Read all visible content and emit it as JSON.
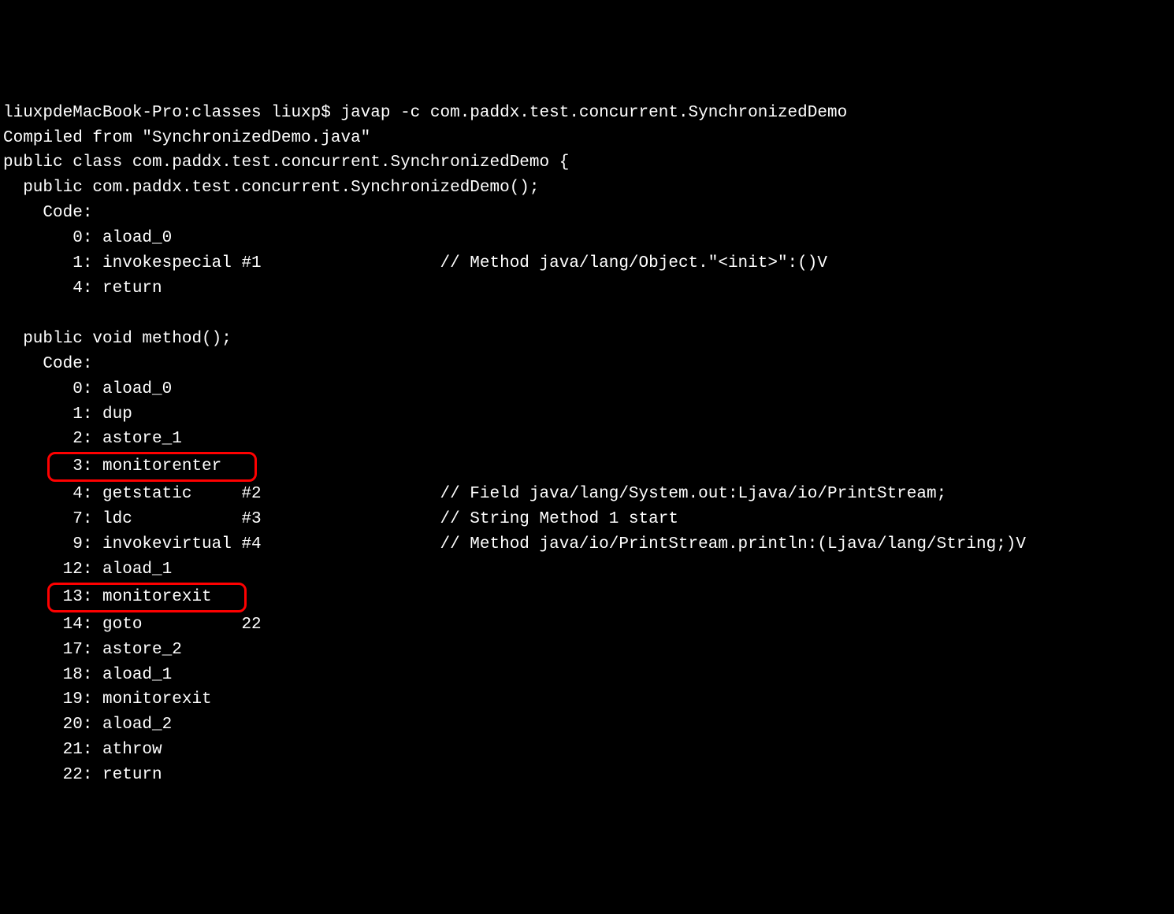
{
  "terminal": {
    "prompt_line": "liuxpdeMacBook-Pro:classes liuxp$ javap -c com.paddx.test.concurrent.SynchronizedDemo",
    "compiled_from": "Compiled from \"SynchronizedDemo.java\"",
    "class_decl": "public class com.paddx.test.concurrent.SynchronizedDemo {",
    "constructor": {
      "signature": "  public com.paddx.test.concurrent.SynchronizedDemo();",
      "code_label": "    Code:",
      "lines": [
        "       0: aload_0",
        "       1: invokespecial #1                  // Method java/lang/Object.\"<init>\":()V",
        "       4: return"
      ]
    },
    "method": {
      "signature": "  public void method();",
      "code_label": "    Code:",
      "lines_before_hl1": [
        "       0: aload_0",
        "       1: dup",
        "       2: astore_1"
      ],
      "hl1": "  3: monitorenter   ",
      "lines_between": [
        "       4: getstatic     #2                  // Field java/lang/System.out:Ljava/io/PrintStream;",
        "       7: ldc           #3                  // String Method 1 start",
        "       9: invokevirtual #4                  // Method java/io/PrintStream.println:(Ljava/lang/String;)V",
        "      12: aload_1"
      ],
      "hl2": " 13: monitorexit   ",
      "lines_after_hl2": [
        "      14: goto          22",
        "      17: astore_2",
        "      18: aload_1",
        "      19: monitorexit",
        "      20: aload_2",
        "      21: athrow",
        "      22: return"
      ]
    }
  }
}
